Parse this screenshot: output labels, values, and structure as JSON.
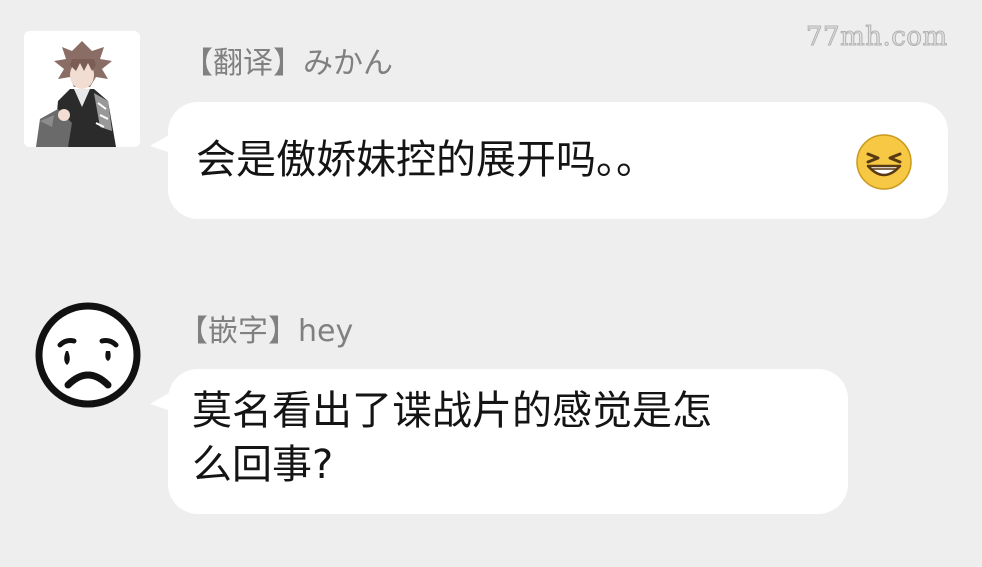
{
  "watermark": "77mh.com",
  "messages": [
    {
      "sender": "【翻译】みかん",
      "text": "会是傲娇妹控的展开吗。。",
      "emoji": "grinning-squint-emoji",
      "avatar": "anime-boy-avatar"
    },
    {
      "sender": "【嵌字】hey",
      "text_line1": "莫名看出了谍战片的感觉是怎",
      "text_line2": "么回事?",
      "avatar": "sad-face-avatar"
    }
  ],
  "colors": {
    "background": "#eeeeee",
    "bubble": "#ffffff",
    "sender_name": "#808080",
    "emoji_yellow": "#f6c843"
  }
}
